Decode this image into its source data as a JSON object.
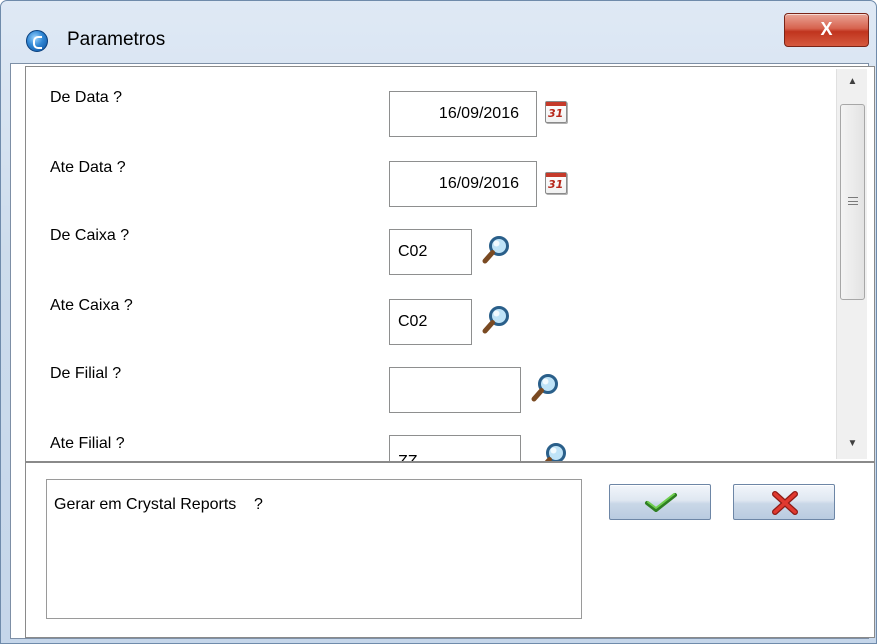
{
  "window": {
    "title": "Parametros",
    "close_label": "X"
  },
  "params": [
    {
      "label": "De Data ?",
      "value": "16/09/2016",
      "type": "date",
      "button_icon": "calendar-icon"
    },
    {
      "label": "Ate Data ?",
      "value": "16/09/2016",
      "type": "date",
      "button_icon": "calendar-icon"
    },
    {
      "label": "De Caixa ?",
      "value": "C02",
      "type": "lookup",
      "button_icon": "search-icon"
    },
    {
      "label": "Ate Caixa ?",
      "value": "C02",
      "type": "lookup",
      "button_icon": "search-icon"
    },
    {
      "label": "De Filial ?",
      "value": "",
      "type": "lookup",
      "button_icon": "search-icon"
    },
    {
      "label": "Ate Filial ?",
      "value": "ZZ",
      "type": "lookup",
      "button_icon": "search-icon"
    }
  ],
  "calendar_icon_text": "31",
  "lower": {
    "question": "Gerar em Crystal Reports    ?",
    "confirm_icon": "checkmark-icon",
    "cancel_icon": "x-icon"
  },
  "colors": {
    "confirm_check": "#3f9b2f",
    "cancel_x": "#d4322a"
  }
}
